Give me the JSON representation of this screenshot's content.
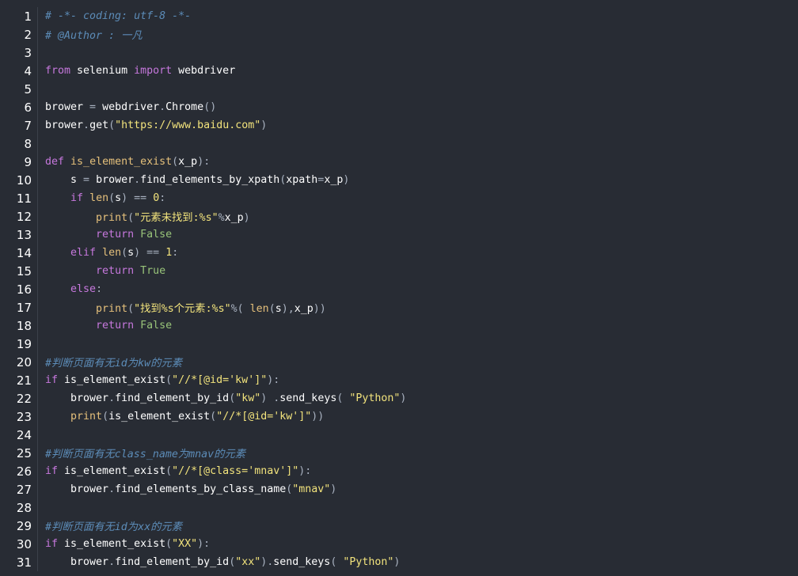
{
  "editor": {
    "colors": {
      "background": "#282c34",
      "default": "#ffffff",
      "comment": "#5c8cb8",
      "keyword": "#c678dd",
      "builtin": "#e5c07b",
      "string": "#f2e37c",
      "number": "#f2e37c",
      "operator": "#a9b2c0",
      "punct": "#a9b2c0",
      "constant": "#98c379"
    },
    "lines": [
      [
        [
          "comment",
          "# -*- coding: utf-8 -*-"
        ]
      ],
      [
        [
          "comment",
          "# @Author : 一凡"
        ]
      ],
      [],
      [
        [
          "keyword",
          "from"
        ],
        [
          "default",
          " selenium "
        ],
        [
          "keyword",
          "import"
        ],
        [
          "default",
          " webdriver"
        ]
      ],
      [],
      [
        [
          "default",
          "brower "
        ],
        [
          "operator",
          "="
        ],
        [
          "default",
          " webdriver"
        ],
        [
          "punct",
          "."
        ],
        [
          "default",
          "Chrome"
        ],
        [
          "punct",
          "()"
        ]
      ],
      [
        [
          "default",
          "brower"
        ],
        [
          "punct",
          "."
        ],
        [
          "default",
          "get"
        ],
        [
          "punct",
          "("
        ],
        [
          "string",
          "\"https://www.baidu.com\""
        ],
        [
          "punct",
          ")"
        ]
      ],
      [],
      [
        [
          "keyword",
          "def"
        ],
        [
          "default",
          " "
        ],
        [
          "builtin",
          "is_element_exist"
        ],
        [
          "punct",
          "("
        ],
        [
          "default",
          "x_p"
        ],
        [
          "punct",
          "):"
        ]
      ],
      [
        [
          "default",
          "    s "
        ],
        [
          "operator",
          "="
        ],
        [
          "default",
          " brower"
        ],
        [
          "punct",
          "."
        ],
        [
          "default",
          "find_elements_by_xpath"
        ],
        [
          "punct",
          "("
        ],
        [
          "default",
          "xpath"
        ],
        [
          "operator",
          "="
        ],
        [
          "default",
          "x_p"
        ],
        [
          "punct",
          ")"
        ]
      ],
      [
        [
          "default",
          "    "
        ],
        [
          "keyword",
          "if"
        ],
        [
          "default",
          " "
        ],
        [
          "builtin",
          "len"
        ],
        [
          "punct",
          "("
        ],
        [
          "default",
          "s"
        ],
        [
          "punct",
          ")"
        ],
        [
          "default",
          " "
        ],
        [
          "operator",
          "=="
        ],
        [
          "default",
          " "
        ],
        [
          "number",
          "0"
        ],
        [
          "punct",
          ":"
        ]
      ],
      [
        [
          "default",
          "        "
        ],
        [
          "builtin",
          "print"
        ],
        [
          "punct",
          "("
        ],
        [
          "string",
          "\"元素未找到:%s\""
        ],
        [
          "operator",
          "%"
        ],
        [
          "default",
          "x_p"
        ],
        [
          "punct",
          ")"
        ]
      ],
      [
        [
          "default",
          "        "
        ],
        [
          "keyword",
          "return"
        ],
        [
          "default",
          " "
        ],
        [
          "constant",
          "False"
        ]
      ],
      [
        [
          "default",
          "    "
        ],
        [
          "keyword",
          "elif"
        ],
        [
          "default",
          " "
        ],
        [
          "builtin",
          "len"
        ],
        [
          "punct",
          "("
        ],
        [
          "default",
          "s"
        ],
        [
          "punct",
          ")"
        ],
        [
          "default",
          " "
        ],
        [
          "operator",
          "=="
        ],
        [
          "default",
          " "
        ],
        [
          "number",
          "1"
        ],
        [
          "punct",
          ":"
        ]
      ],
      [
        [
          "default",
          "        "
        ],
        [
          "keyword",
          "return"
        ],
        [
          "default",
          " "
        ],
        [
          "constant",
          "True"
        ]
      ],
      [
        [
          "default",
          "    "
        ],
        [
          "keyword",
          "else"
        ],
        [
          "punct",
          ":"
        ]
      ],
      [
        [
          "default",
          "        "
        ],
        [
          "builtin",
          "print"
        ],
        [
          "punct",
          "("
        ],
        [
          "string",
          "\"找到%s个元素:%s\""
        ],
        [
          "operator",
          "%"
        ],
        [
          "punct",
          "("
        ],
        [
          "default",
          " "
        ],
        [
          "builtin",
          "len"
        ],
        [
          "punct",
          "("
        ],
        [
          "default",
          "s"
        ],
        [
          "punct",
          "),"
        ],
        [
          "default",
          "x_p"
        ],
        [
          "punct",
          "))"
        ]
      ],
      [
        [
          "default",
          "        "
        ],
        [
          "keyword",
          "return"
        ],
        [
          "default",
          " "
        ],
        [
          "constant",
          "False"
        ]
      ],
      [],
      [
        [
          "comment",
          "#判断页面有无id为kw的元素"
        ]
      ],
      [
        [
          "keyword",
          "if"
        ],
        [
          "default",
          " is_element_exist"
        ],
        [
          "punct",
          "("
        ],
        [
          "string",
          "\"//*[@id='kw']\""
        ],
        [
          "punct",
          "):"
        ]
      ],
      [
        [
          "default",
          "    brower"
        ],
        [
          "punct",
          "."
        ],
        [
          "default",
          "find_element_by_id"
        ],
        [
          "punct",
          "("
        ],
        [
          "string",
          "\"kw\""
        ],
        [
          "punct",
          ")"
        ],
        [
          "default",
          " "
        ],
        [
          "punct",
          "."
        ],
        [
          "default",
          "send_keys"
        ],
        [
          "punct",
          "("
        ],
        [
          "default",
          " "
        ],
        [
          "string",
          "\"Python\""
        ],
        [
          "punct",
          ")"
        ]
      ],
      [
        [
          "default",
          "    "
        ],
        [
          "builtin",
          "print"
        ],
        [
          "punct",
          "("
        ],
        [
          "default",
          "is_element_exist"
        ],
        [
          "punct",
          "("
        ],
        [
          "string",
          "\"//*[@id='kw']\""
        ],
        [
          "punct",
          "))"
        ]
      ],
      [],
      [
        [
          "comment",
          "#判断页面有无class_name为mnav的元素"
        ]
      ],
      [
        [
          "keyword",
          "if"
        ],
        [
          "default",
          " is_element_exist"
        ],
        [
          "punct",
          "("
        ],
        [
          "string",
          "\"//*[@class='mnav']\""
        ],
        [
          "punct",
          "):"
        ]
      ],
      [
        [
          "default",
          "    brower"
        ],
        [
          "punct",
          "."
        ],
        [
          "default",
          "find_elements_by_class_name"
        ],
        [
          "punct",
          "("
        ],
        [
          "string",
          "\"mnav\""
        ],
        [
          "punct",
          ")"
        ]
      ],
      [],
      [
        [
          "comment",
          "#判断页面有无id为xx的元素"
        ]
      ],
      [
        [
          "keyword",
          "if"
        ],
        [
          "default",
          " is_element_exist"
        ],
        [
          "punct",
          "("
        ],
        [
          "string",
          "\"XX\""
        ],
        [
          "punct",
          "):"
        ]
      ],
      [
        [
          "default",
          "    brower"
        ],
        [
          "punct",
          "."
        ],
        [
          "default",
          "find_element_by_id"
        ],
        [
          "punct",
          "("
        ],
        [
          "string",
          "\"xx\""
        ],
        [
          "punct",
          ")."
        ],
        [
          "default",
          "send_keys"
        ],
        [
          "punct",
          "("
        ],
        [
          "default",
          " "
        ],
        [
          "string",
          "\"Python\""
        ],
        [
          "punct",
          ")"
        ]
      ]
    ]
  }
}
